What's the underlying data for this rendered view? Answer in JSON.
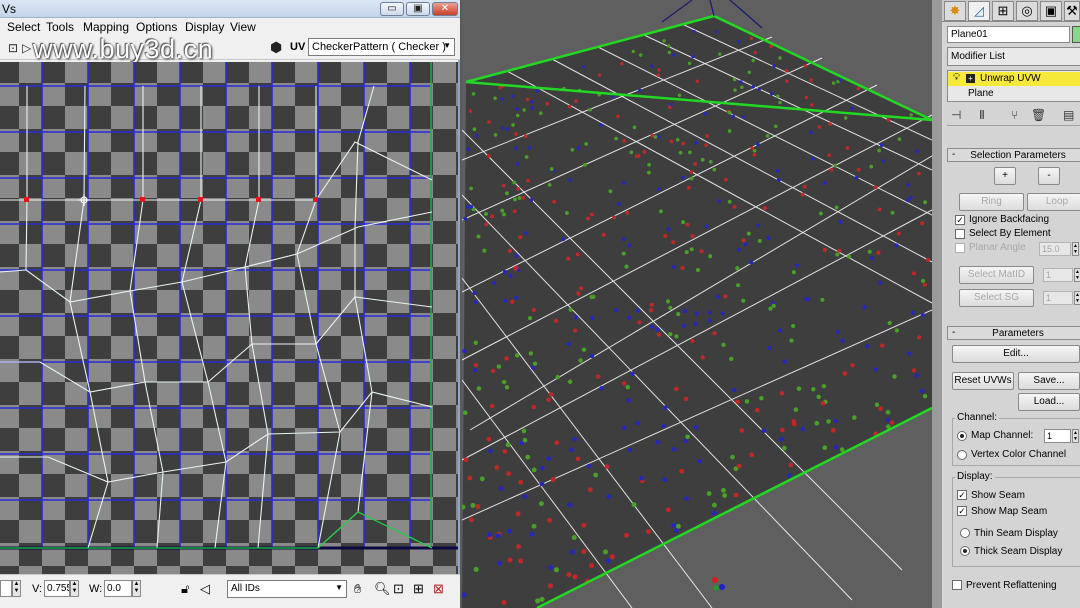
{
  "uv_editor": {
    "title": "Vs",
    "menu": [
      "Select",
      "Tools",
      "Mapping",
      "Options",
      "Display",
      "View"
    ],
    "watermark": "www.buy3d.cn",
    "uv_label": "UV",
    "checker_pattern": "CheckerPattern  ( Checker )",
    "bottom": {
      "v_label": "V:",
      "v_value": "0.755",
      "w_label": "W:",
      "w_value": "0.0",
      "ids_value": "All IDs"
    }
  },
  "command_panel": {
    "object_name": "Plane01",
    "object_color": "#88d788",
    "modifier_list_label": "Modifier List",
    "stack": [
      "Unwrap UVW",
      "Plane"
    ],
    "active_stack_color": "#f7e93a",
    "selection_parameters": {
      "title": "Selection Parameters",
      "grow_label": "+",
      "shrink_label": "-",
      "ring_label": "Ring",
      "loop_label": "Loop",
      "ignore_backfacing_label": "Ignore Backfacing",
      "ignore_backfacing": true,
      "select_by_element_label": "Select By Element",
      "select_by_element": false,
      "planar_angle_label": "Planar Angle",
      "planar_angle_value": "15.0",
      "select_matid_label": "Select MatID",
      "select_matid_value": "1",
      "select_sg_label": "Select SG",
      "select_sg_value": "1"
    },
    "parameters": {
      "title": "Parameters",
      "edit_label": "Edit...",
      "reset_label": "Reset UVWs",
      "save_label": "Save...",
      "load_label": "Load...",
      "channel_group": "Channel:",
      "map_channel_label": "Map Channel:",
      "map_channel_value": "1",
      "vertex_color_label": "Vertex Color Channel",
      "display_group": "Display:",
      "show_seam_label": "Show Seam",
      "show_seam": true,
      "show_map_seam_label": "Show Map Seam",
      "show_map_seam": true,
      "thin_seam_label": "Thin Seam Display",
      "thick_seam_label": "Thick Seam Display",
      "seam_display": "thick",
      "prevent_reflattening_label": "Prevent Reflattening",
      "prevent_reflattening": false
    }
  }
}
